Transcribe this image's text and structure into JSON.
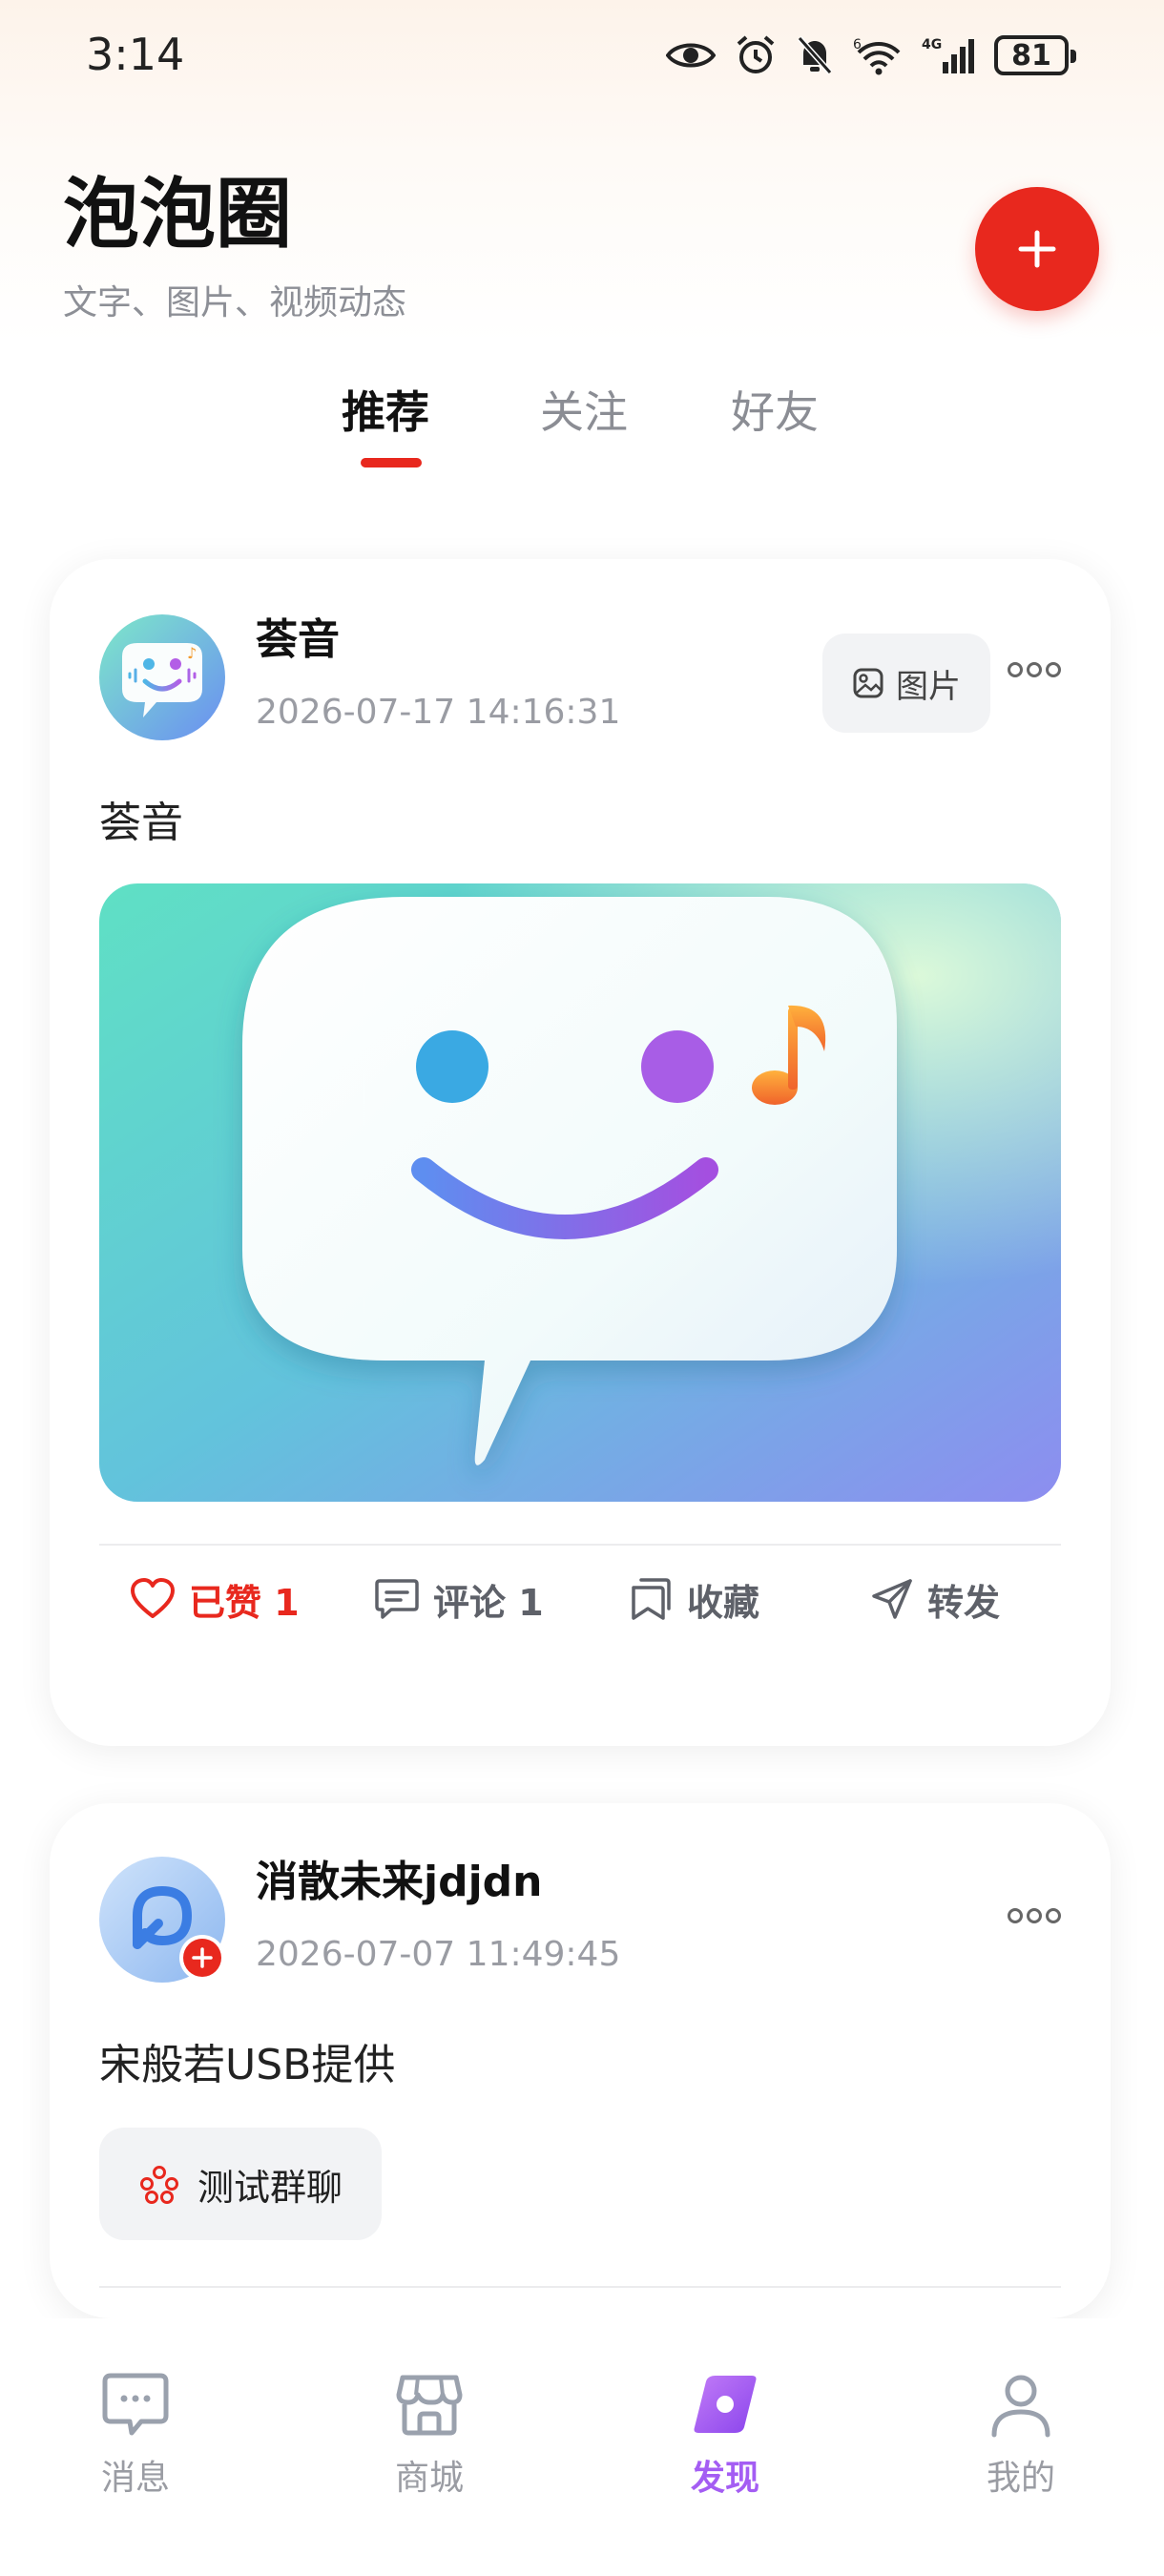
{
  "status_bar": {
    "time": "3:14",
    "network": "4G",
    "sim": "6",
    "battery": "81"
  },
  "header": {
    "title": "泡泡圈",
    "subtitle": "文字、图片、视频动态",
    "add_icon": "plus-icon"
  },
  "tabs": [
    {
      "label": "推荐",
      "active": true
    },
    {
      "label": "关注",
      "active": false
    },
    {
      "label": "好友",
      "active": false
    }
  ],
  "posts": [
    {
      "username": "荟音",
      "time": "2026-07-17 14:16:31",
      "type_label": "图片",
      "text": "荟音",
      "actions": {
        "like": "已赞 1",
        "comment": "评论 1",
        "favorite": "收藏",
        "share": "转发"
      }
    },
    {
      "username": "消散未来jdjdn",
      "time": "2026-07-07 11:49:45",
      "text": "宋般若USB提供",
      "group_chip": "测试群聊"
    }
  ],
  "bottom_nav": [
    {
      "label": "消息",
      "icon": "message-icon",
      "active": false
    },
    {
      "label": "商城",
      "icon": "store-icon",
      "active": false
    },
    {
      "label": "发现",
      "icon": "discover-icon",
      "active": true
    },
    {
      "label": "我的",
      "icon": "profile-icon",
      "active": false
    }
  ],
  "colors": {
    "accent_red": "#e8281e",
    "active_purple": "#a45df3"
  }
}
